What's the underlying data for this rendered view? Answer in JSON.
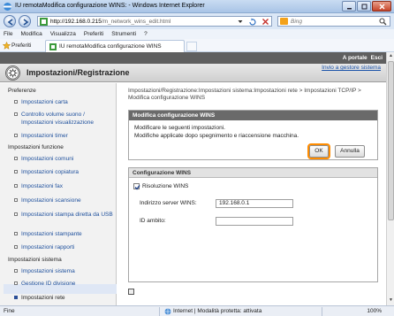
{
  "window": {
    "title": "IU remotaModifica configurazione WINS: - Windows Internet Explorer"
  },
  "address": {
    "url_host": "http://192.168.0.215",
    "url_rest": "/m_network_wins_edit.html",
    "search_placeholder": "Bing"
  },
  "menu": [
    "File",
    "Modifica",
    "Visualizza",
    "Preferiti",
    "Strumenti",
    "?"
  ],
  "favorites": {
    "label": "Preferiti",
    "tab_title": "IU remotaModifica configurazione WINS"
  },
  "portal": {
    "links": [
      "A portale",
      "Esci"
    ],
    "page_title": "Impostazioni/Registrazione",
    "admin_link": "Invio a gestore sistema"
  },
  "sidebar": {
    "sections": [
      {
        "title": "Preferenze",
        "items": [
          "Impostazioni carta",
          "Controllo volume suono / Impostazioni visualizzazione",
          "Impostazioni timer"
        ]
      },
      {
        "title": "Impostazioni funzione",
        "items": [
          "Impostazioni comuni",
          "Impostazioni copiatura",
          "Impostazioni fax",
          "Impostazioni scansione",
          "Impostazioni stampa diretta da USB",
          "Impostazioni stampante",
          "Impostazioni rapporti"
        ]
      },
      {
        "title": "Impostazioni sistema",
        "items": [
          "Impostazioni sistema",
          "Gestione ID divisione",
          "Impostazioni rete"
        ]
      }
    ],
    "active_item": "Impostazioni rete"
  },
  "main": {
    "breadcrumb": "Impostazioni/Registrazione:Impostazioni sistema:Impostazioni rete > Impostazioni TCP/IP > Modifica configurazione WINS",
    "confirm_box": {
      "title": "Modifica configurazione WINS",
      "line1": "Modificare le seguenti impostazioni.",
      "line2": "Modifiche applicate dopo spegnimento e riaccensione macchina.",
      "ok_label": "OK",
      "cancel_label": "Annulla"
    },
    "config_box": {
      "title": "Configurazione WINS",
      "checkbox_label": "Risoluzione WINS",
      "checkbox_checked": true,
      "server_label": "Indirizzo server WINS:",
      "server_value": "192.168.0.1",
      "scope_label": "ID ambito:",
      "scope_value": ""
    }
  },
  "status": {
    "left": "Fine",
    "zone": "Internet | Modalità protetta: attivata",
    "zoom": "100%"
  },
  "colors": {
    "link": "#1d4f9c",
    "header_dark": "#5f5f5f",
    "ok_highlight": "#ff8c00"
  }
}
